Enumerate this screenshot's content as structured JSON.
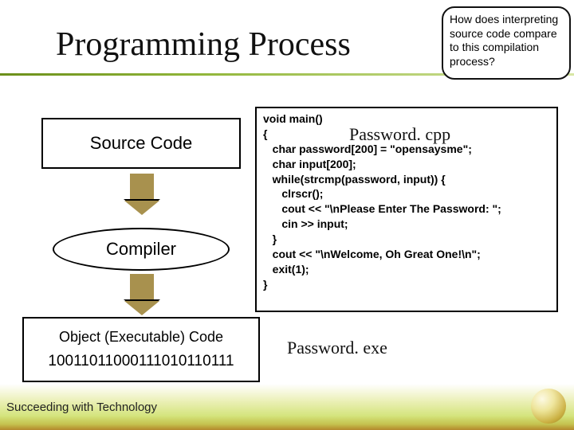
{
  "title": "Programming Process",
  "callout": "How does interpreting source code compare to this compilation process?",
  "boxes": {
    "source": "Source Code",
    "compiler": "Compiler",
    "object_label": "Object (Executable) Code",
    "object_bits": "10011011000111010110111"
  },
  "code": {
    "filename": "Password. cpp",
    "lines": [
      "void main()",
      "{",
      "   char password[200] = \"opensaysme\";",
      "   char input[200];",
      "   while(strcmp(password, input)) {",
      "      clrscr();",
      "      cout << \"\\nPlease Enter The Password: \";",
      "      cin >> input;",
      "",
      "   }",
      "   cout << \"\\nWelcome, Oh Great One!\\n\";",
      "   exit(1);",
      "}"
    ]
  },
  "exe_label": "Password. exe",
  "footer": "Succeeding with Technology",
  "colors": {
    "accent": "#a8914e",
    "rule": "#8aad2a"
  }
}
